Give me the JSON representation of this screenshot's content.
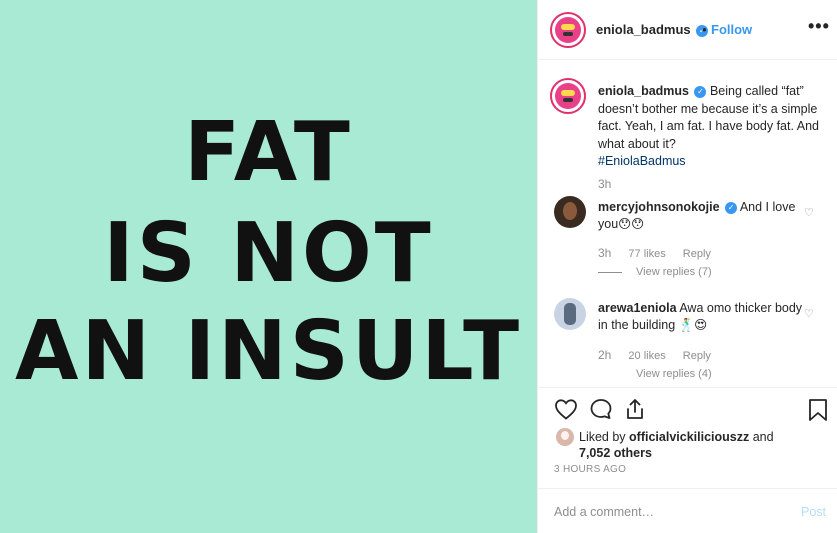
{
  "post": {
    "image_lines": [
      "FAT",
      "IS NOT",
      "AN INSULT"
    ],
    "image_bg": "#a8ead4"
  },
  "header": {
    "username": "eniola_badmus",
    "dot": "•",
    "follow_label": "Follow",
    "more_label": "•••"
  },
  "caption": {
    "username": "eniola_badmus",
    "text": "Being called “fat” doesn’t bother me because it’s a simple fact. Yeah, I am fat. I have body fat. And what about it?",
    "hashtag": "#EniolaBadmus",
    "time": "3h"
  },
  "comments": [
    {
      "username": "mercyjohnsonokojie",
      "text": "And I love you😯😯",
      "time": "3h",
      "likes": "77 likes",
      "reply_label": "Reply",
      "view_replies": "View replies (7)"
    },
    {
      "username": "arewa1eniola",
      "text": "Awa omo thicker body in the building 🕺😍",
      "time": "2h",
      "likes": "20 likes",
      "reply_label": "Reply",
      "view_replies": "View replies (4)"
    }
  ],
  "likes": {
    "prefix": "Liked by",
    "user": "officialvickiliciouszz",
    "joiner": "and",
    "others": "7,052 others"
  },
  "posted_time": "3 HOURS AGO",
  "add_comment": {
    "placeholder": "Add a comment…",
    "post_label": "Post"
  },
  "colors": {
    "accent": "#3897f0",
    "hashtag": "#003569",
    "muted": "#8e8e8e"
  },
  "icons": [
    "verified-icon",
    "more-icon",
    "heart-icon",
    "comment-icon",
    "share-icon",
    "bookmark-icon"
  ]
}
